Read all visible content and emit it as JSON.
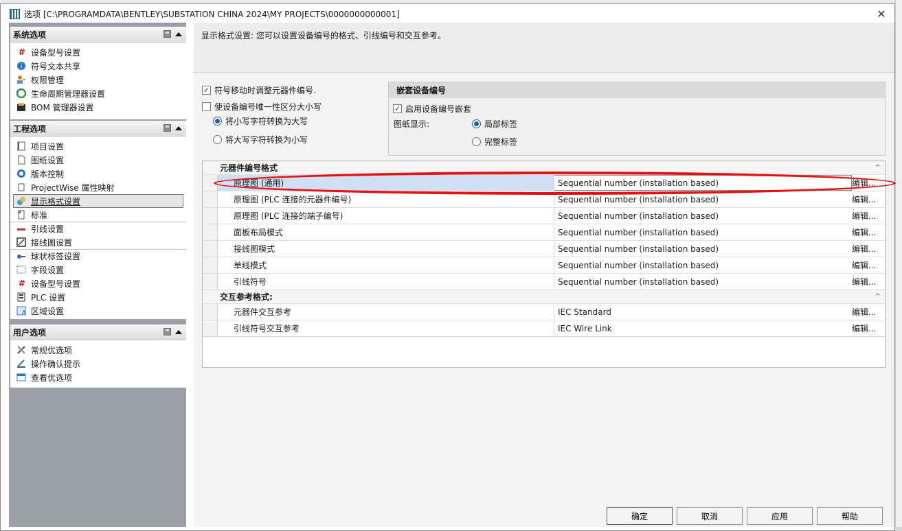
{
  "window": {
    "title": "选项 [C:\\PROGRAMDATA\\BENTLEY\\SUBSTATION CHINA 2024\\MY PROJECTS\\0000000000001]",
    "close_glyph": "✕"
  },
  "groups": {
    "system": {
      "title": "系统选项",
      "items": [
        {
          "label": "设备型号设置",
          "icon": "hash-icon"
        },
        {
          "label": "符号文本共享",
          "icon": "info-globe-icon"
        },
        {
          "label": "权限管理",
          "icon": "user-key-icon"
        },
        {
          "label": "生命周期管理器设置",
          "icon": "lifecycle-icon"
        },
        {
          "label": "BOM 管理器设置",
          "icon": "bom-icon"
        }
      ]
    },
    "project": {
      "title": "工程选项",
      "items": [
        {
          "label": "项目设置",
          "icon": "book-icon"
        },
        {
          "label": "图纸设置",
          "icon": "page-icon"
        },
        {
          "label": "版本控制",
          "icon": "version-icon"
        },
        {
          "label": "ProjectWise 属性映射",
          "icon": "projectwise-icon"
        },
        {
          "label": "显示格式设置",
          "icon": "display-format-icon"
        },
        {
          "label": "标准",
          "icon": "standard-icon"
        },
        {
          "label": "引线设置",
          "icon": "wire-icon"
        },
        {
          "label": "接线图设置",
          "icon": "wiring-diagram-icon"
        },
        {
          "label": "球状标签设置",
          "icon": "balloon-icon"
        },
        {
          "label": "字段设置",
          "icon": "field-icon"
        },
        {
          "label": "设备型号设置",
          "icon": "hash-icon"
        },
        {
          "label": "PLC 设置",
          "icon": "plc-icon"
        },
        {
          "label": "区域设置",
          "icon": "area-icon"
        }
      ]
    },
    "user": {
      "title": "用户选项",
      "items": [
        {
          "label": "常规优选项",
          "icon": "tools-icon"
        },
        {
          "label": "操作确认提示",
          "icon": "confirm-icon"
        },
        {
          "label": "查看优选项",
          "icon": "window-icon"
        }
      ]
    }
  },
  "main": {
    "description": "显示格式设置: 您可以设置设备编号的格式、引线编号和交互参考。",
    "options": {
      "adjust_on_move": {
        "label": "符号移动时调整元器件编号.",
        "checked": true
      },
      "case_sensitive": {
        "label": "使设备编号唯一性区分大小写",
        "checked": false
      },
      "to_upper": {
        "label": "将小写字符转换为大写",
        "selected": true
      },
      "to_lower": {
        "label": "将大写字符转换为小写",
        "selected": false
      }
    },
    "nesting": {
      "title": "嵌套设备编号",
      "enable_label": "启用设备编号嵌套",
      "enable_checked": true,
      "display_label": "图纸显示:",
      "partial_label": "局部标签",
      "full_label": "完整标签"
    },
    "grid": {
      "device_format_title": "元器件编号格式",
      "device_rows": [
        {
          "name": "原理图 (通用)",
          "value": "Sequential number (installation based)",
          "edit": "编辑..."
        },
        {
          "name": "原理图 (PLC 连接的元器件编号)",
          "value": "Sequential number (installation based)",
          "edit": "编辑..."
        },
        {
          "name": "原理图 (PLC 连接的端子编号)",
          "value": "Sequential number (installation based)",
          "edit": "编辑..."
        },
        {
          "name": "面板布局模式",
          "value": "Sequential number (installation based)",
          "edit": "编辑..."
        },
        {
          "name": "接线图模式",
          "value": "Sequential number (installation based)",
          "edit": "编辑..."
        },
        {
          "name": "单线模式",
          "value": "Sequential number (installation based)",
          "edit": "编辑..."
        },
        {
          "name": "引线符号",
          "value": "Sequential number (installation based)",
          "edit": "编辑..."
        }
      ],
      "xref_title": "交互参考格式:",
      "xref_rows": [
        {
          "name": "元器件交互参考",
          "value": "IEC Standard",
          "edit": "编辑..."
        },
        {
          "name": "引线符号交互参考",
          "value": "IEC Wire Link",
          "edit": "编辑..."
        }
      ]
    }
  },
  "buttons": {
    "ok": "确定",
    "cancel": "取消",
    "apply": "应用",
    "help": "帮助"
  },
  "colors": {
    "highlight": "#e81010",
    "selected_row": "#cfe0f5",
    "radio_accent": "#1f5fa8"
  }
}
